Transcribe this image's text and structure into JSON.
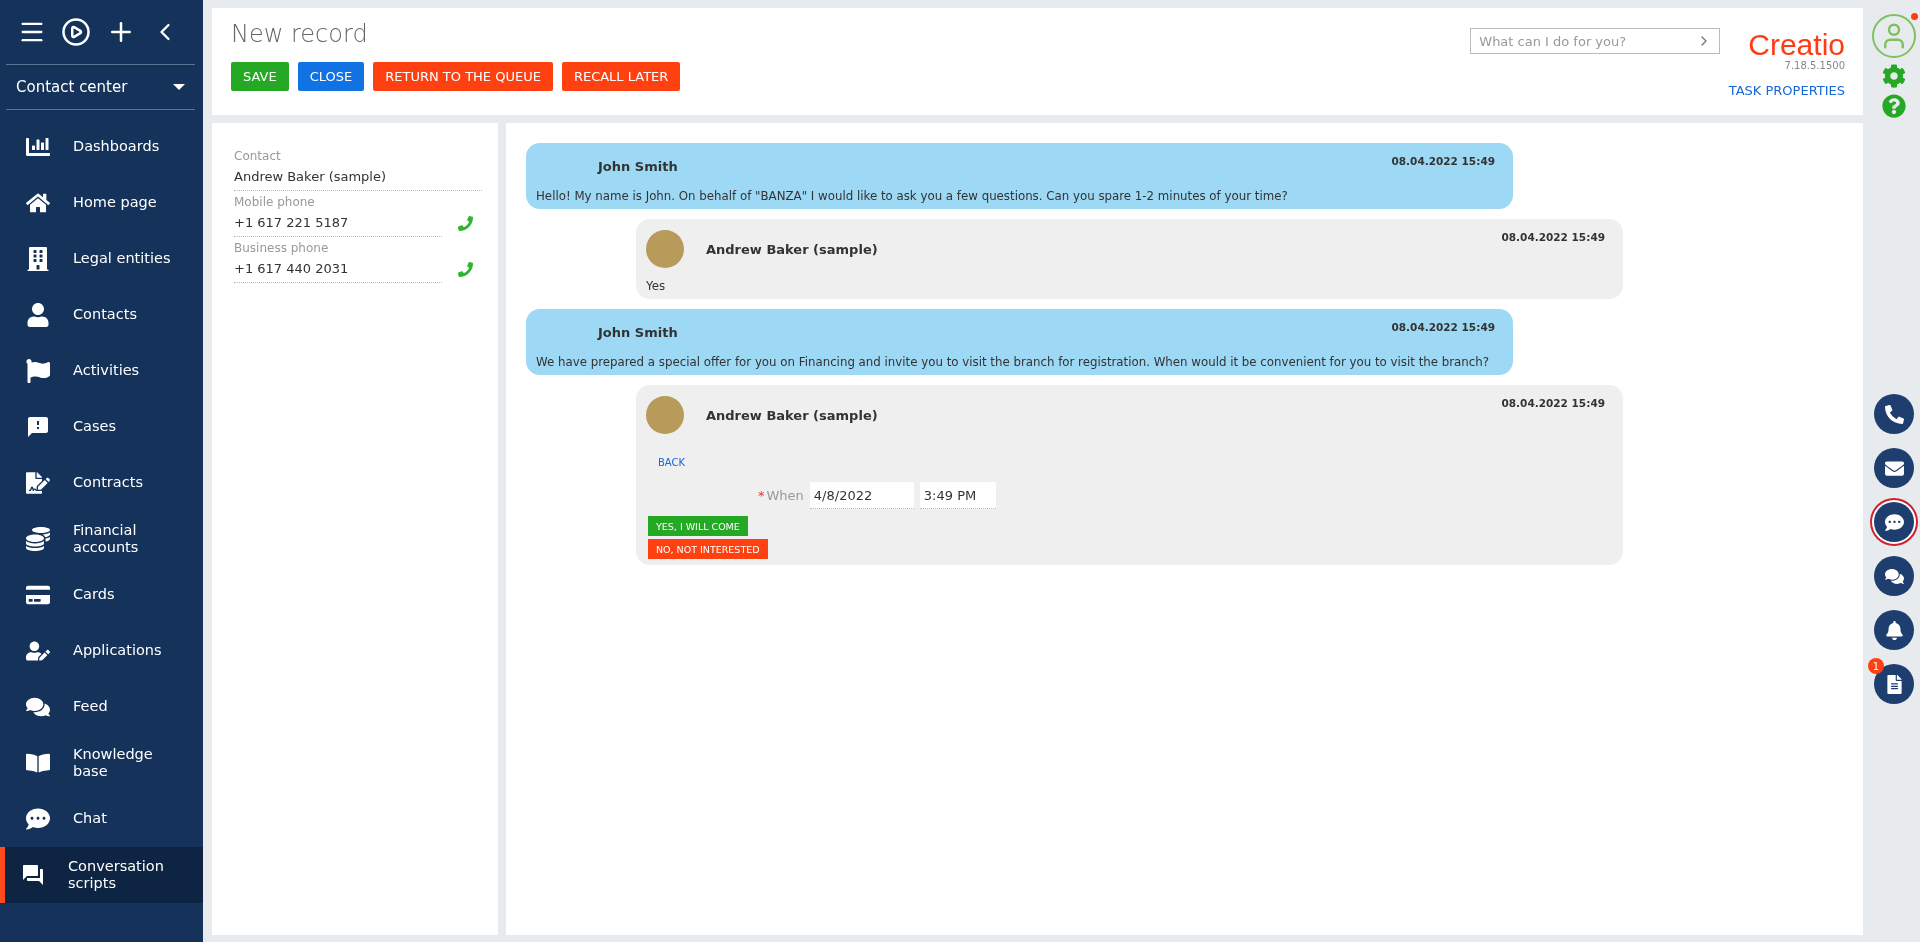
{
  "sidebar": {
    "workplace": "Contact center",
    "items": [
      {
        "label": "Dashboards",
        "selected": false
      },
      {
        "label": "Home page",
        "selected": false
      },
      {
        "label": "Legal entities",
        "selected": false
      },
      {
        "label": "Contacts",
        "selected": false
      },
      {
        "label": "Activities",
        "selected": false
      },
      {
        "label": "Cases",
        "selected": false
      },
      {
        "label": "Contracts",
        "selected": false
      },
      {
        "label": "Financial accounts",
        "selected": false
      },
      {
        "label": "Cards",
        "selected": false
      },
      {
        "label": "Applications",
        "selected": false
      },
      {
        "label": "Feed",
        "selected": false
      },
      {
        "label": "Knowledge base",
        "selected": false
      },
      {
        "label": "Chat",
        "selected": false
      },
      {
        "label": "Conversation scripts",
        "selected": true
      }
    ]
  },
  "header": {
    "title": "New record",
    "buttons": [
      {
        "label": "SAVE",
        "kind": "green"
      },
      {
        "label": "CLOSE",
        "kind": "blue"
      },
      {
        "label": "RETURN TO THE QUEUE",
        "kind": "red"
      },
      {
        "label": "RECALL LATER",
        "kind": "red"
      }
    ],
    "search": {
      "placeholder": "What can I do for you?"
    },
    "logo": "Creatio",
    "version": "7.18.5.1500",
    "task_link": "TASK PROPERTIES"
  },
  "contact_panel": {
    "fields": [
      {
        "label": "Contact",
        "value": "Andrew Baker (sample)",
        "kind": "text"
      },
      {
        "label": "Mobile phone",
        "value": "+1 617 221 5187",
        "kind": "phone"
      },
      {
        "label": "Business phone",
        "value": "+1 617 440 2031",
        "kind": "phone"
      }
    ]
  },
  "messages": [
    {
      "kind": "operator",
      "author": "John Smith",
      "time": "08.04.2022 15:49",
      "text": "Hello! My name is John. On behalf of \"BANZA\" I would like to ask you a few questions. Can you spare 1-2 minutes of your time?"
    },
    {
      "kind": "client",
      "author": "Andrew Baker (sample)",
      "time": "08.04.2022 15:49",
      "text": "Yes"
    },
    {
      "kind": "operator",
      "author": "John Smith",
      "time": "08.04.2022 15:49",
      "text": "We have prepared a special offer for you on Financing and invite you to visit the branch for registration. When would it be convenient for you to visit the branch?"
    },
    {
      "kind": "client",
      "author": "Andrew Baker (sample)",
      "time": "08.04.2022 15:49",
      "form": {
        "back": "BACK",
        "field_label": "When",
        "required_mark": "*",
        "date": "4/8/2022",
        "time": "3:49 PM",
        "answers": [
          {
            "label": "YES, I WILL COME",
            "kind": "green"
          },
          {
            "label": "NO, NOT INTERESTED",
            "kind": "red"
          }
        ]
      }
    }
  ],
  "right_rail": {
    "profile_notification": true,
    "buttons": [
      {
        "selected": false
      },
      {
        "selected": false
      },
      {
        "selected": true
      },
      {
        "selected": false
      },
      {
        "selected": false
      },
      {
        "selected": false,
        "badge": "1"
      }
    ]
  }
}
